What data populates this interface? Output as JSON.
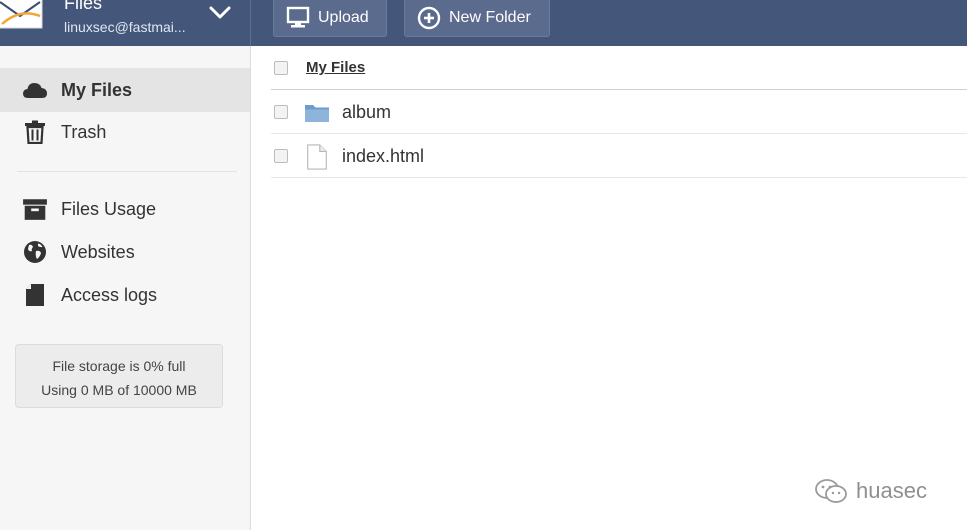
{
  "app": {
    "title": "Files",
    "account": "linuxsec@fastmai..."
  },
  "toolbar": {
    "upload_label": "Upload",
    "new_folder_label": "New Folder"
  },
  "sidebar": {
    "items": [
      {
        "label": "My Files",
        "icon": "cloud-icon",
        "active": true
      },
      {
        "label": "Trash",
        "icon": "trash-icon",
        "active": false
      },
      {
        "label": "Files Usage",
        "icon": "archive-icon",
        "active": false
      },
      {
        "label": "Websites",
        "icon": "globe-icon",
        "active": false
      },
      {
        "label": "Access logs",
        "icon": "file-icon",
        "active": false
      }
    ],
    "storage": {
      "line1": "File storage is 0% full",
      "line2": "Using 0 MB of 10000 MB"
    }
  },
  "main": {
    "header": "My Files",
    "files": [
      {
        "name": "album",
        "type": "folder",
        "icon": "folder-icon"
      },
      {
        "name": "index.html",
        "type": "file",
        "icon": "document-icon"
      }
    ]
  },
  "watermark": {
    "text": "huasec",
    "icon": "wechat-icon"
  },
  "colors": {
    "topbar": "#44567a",
    "button": "#5a6b8d",
    "sidebar": "#f6f6f6",
    "active_item": "#e4e4e4",
    "folder": "#7fa7d3"
  }
}
